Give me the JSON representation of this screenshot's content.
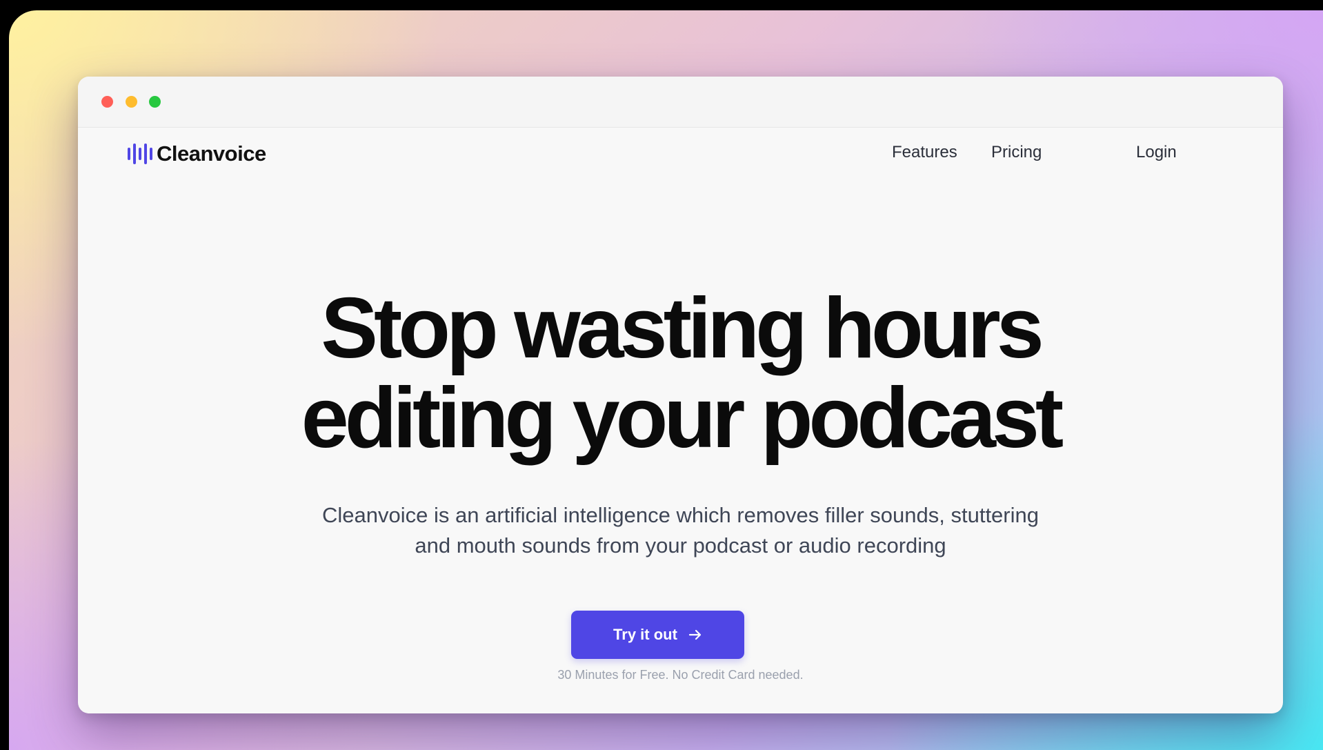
{
  "brand": {
    "name": "Cleanvoice",
    "accent_color": "#4f46e5",
    "logo_icon": "waveform-icon"
  },
  "window_controls": {
    "close_color": "#ff5f57",
    "minimize_color": "#febc2e",
    "maximize_color": "#28c840"
  },
  "nav": {
    "features": "Features",
    "pricing": "Pricing",
    "login": "Login"
  },
  "hero": {
    "title_line1": "Stop wasting hours",
    "title_line2": "editing your podcast",
    "subtitle_line1": "Cleanvoice is an artificial intelligence which removes filler sounds, stuttering",
    "subtitle_line2": "and mouth sounds from your podcast or audio recording"
  },
  "cta": {
    "label": "Try it out",
    "icon": "arrow-right-icon",
    "note": "30 Minutes for Free. No Credit Card needed."
  }
}
